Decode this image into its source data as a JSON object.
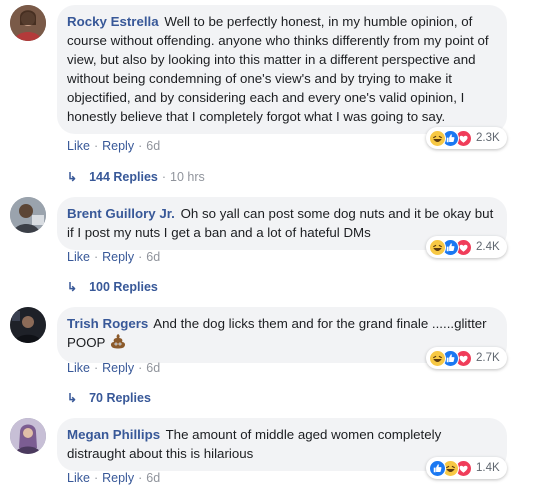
{
  "comments": [
    {
      "author": "Rocky Estrella",
      "text": "Well to be perfectly honest, in my humble opinion, of course without offending. anyone who thinks differently from my point of view, but also by looking into this matter in a different perspective and without being condemning of one's view's and by trying to make it objectified, and by considering each and every one's valid opinion, I honestly believe that I completely forgot what I was going to say.",
      "reactions": [
        "haha",
        "like",
        "love"
      ],
      "reaction_count": "2.3K",
      "like_label": "Like",
      "reply_label": "Reply",
      "time": "6d",
      "replies_label": "144 Replies",
      "replies_time": "10 hrs"
    },
    {
      "author": "Brent Guillory Jr.",
      "text": "Oh so yall can post some dog nuts and it be okay but if I post my nuts I get a ban and a lot of hateful DMs",
      "reactions": [
        "haha",
        "like",
        "love"
      ],
      "reaction_count": "2.4K",
      "like_label": "Like",
      "reply_label": "Reply",
      "time": "6d",
      "replies_label": "100 Replies"
    },
    {
      "author": "Trish Rogers",
      "text": "And the dog licks them and for the grand finale ......glitter POOP",
      "emoji": "poop-emoji",
      "reactions": [
        "haha",
        "like",
        "love"
      ],
      "reaction_count": "2.7K",
      "like_label": "Like",
      "reply_label": "Reply",
      "time": "6d",
      "replies_label": "70 Replies"
    },
    {
      "author": "Megan Phillips",
      "text": "The amount of middle aged women completely distraught about this is hilarious",
      "reactions": [
        "like",
        "haha",
        "love"
      ],
      "reaction_count": "1.4K",
      "like_label": "Like",
      "reply_label": "Reply",
      "time": "6d"
    }
  ],
  "colors": {
    "link": "#385898",
    "bubble": "#f2f3f5",
    "meta": "#90949c"
  }
}
